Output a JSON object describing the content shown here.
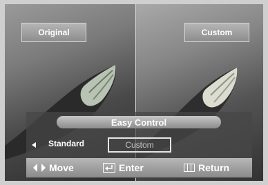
{
  "comparison": {
    "left_caption": "Original",
    "right_caption": "Custom"
  },
  "menu": {
    "title": "Easy Control",
    "selected_option": "Standard",
    "preview_option": "Custom"
  },
  "footer": {
    "move_label": "Move",
    "enter_label": "Enter",
    "return_label": "Return"
  },
  "icons": {
    "move": "left-right-arrows-icon",
    "enter": "enter-key-icon",
    "return": "return-menu-icon",
    "previous": "arrow-left-icon"
  },
  "colors": {
    "panel_bar": "#a0a0a0",
    "text": "#ffffff"
  }
}
